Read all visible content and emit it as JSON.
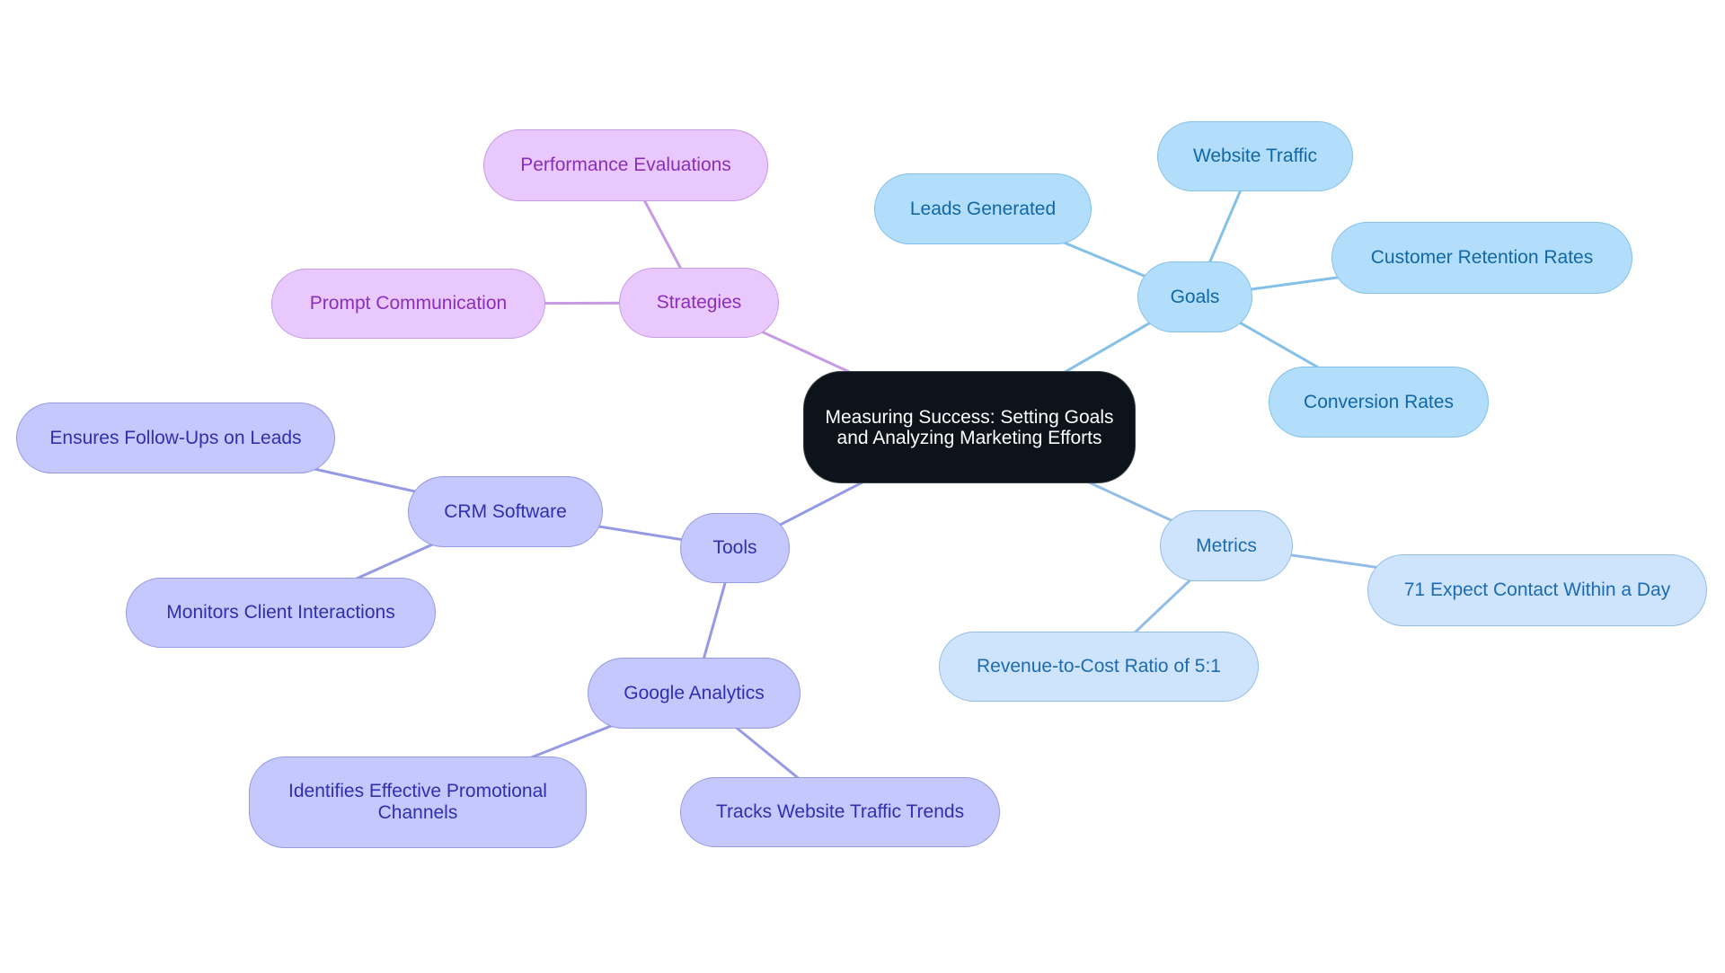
{
  "diagram": {
    "type": "mindmap",
    "root": {
      "id": "root",
      "label": "Measuring Success: Setting Goals and Analyzing Marketing Efforts",
      "color": "#0c131a"
    },
    "branches": [
      {
        "id": "strategies",
        "label": "Strategies",
        "color": "#c79ae8",
        "children": [
          {
            "id": "performance-evaluations",
            "label": "Performance Evaluations"
          },
          {
            "id": "prompt-communication",
            "label": "Prompt Communication"
          }
        ]
      },
      {
        "id": "goals",
        "label": "Goals",
        "color": "#84c1ea",
        "children": [
          {
            "id": "leads-generated",
            "label": "Leads Generated"
          },
          {
            "id": "website-traffic",
            "label": "Website Traffic"
          },
          {
            "id": "customer-retention-rates",
            "label": "Customer Retention Rates"
          },
          {
            "id": "conversion-rates",
            "label": "Conversion Rates"
          }
        ]
      },
      {
        "id": "metrics",
        "label": "Metrics",
        "color": "#93bde8",
        "children": [
          {
            "id": "expect-contact",
            "label": "71 Expect Contact Within a Day"
          },
          {
            "id": "revenue-ratio",
            "label": "Revenue-to-Cost Ratio of 5:1"
          }
        ]
      },
      {
        "id": "tools",
        "label": "Tools",
        "color": "#9699e4",
        "children": [
          {
            "id": "crm-software",
            "label": "CRM Software",
            "children": [
              {
                "id": "ensures-follow-ups",
                "label": "Ensures Follow-Ups on Leads"
              },
              {
                "id": "monitors-client",
                "label": "Monitors Client Interactions"
              }
            ]
          },
          {
            "id": "google-analytics",
            "label": "Google Analytics",
            "children": [
              {
                "id": "identifies-channels",
                "label": "Identifies Effective Promotional Channels"
              },
              {
                "id": "tracks-traffic",
                "label": "Tracks Website Traffic Trends"
              }
            ]
          }
        ]
      }
    ]
  }
}
